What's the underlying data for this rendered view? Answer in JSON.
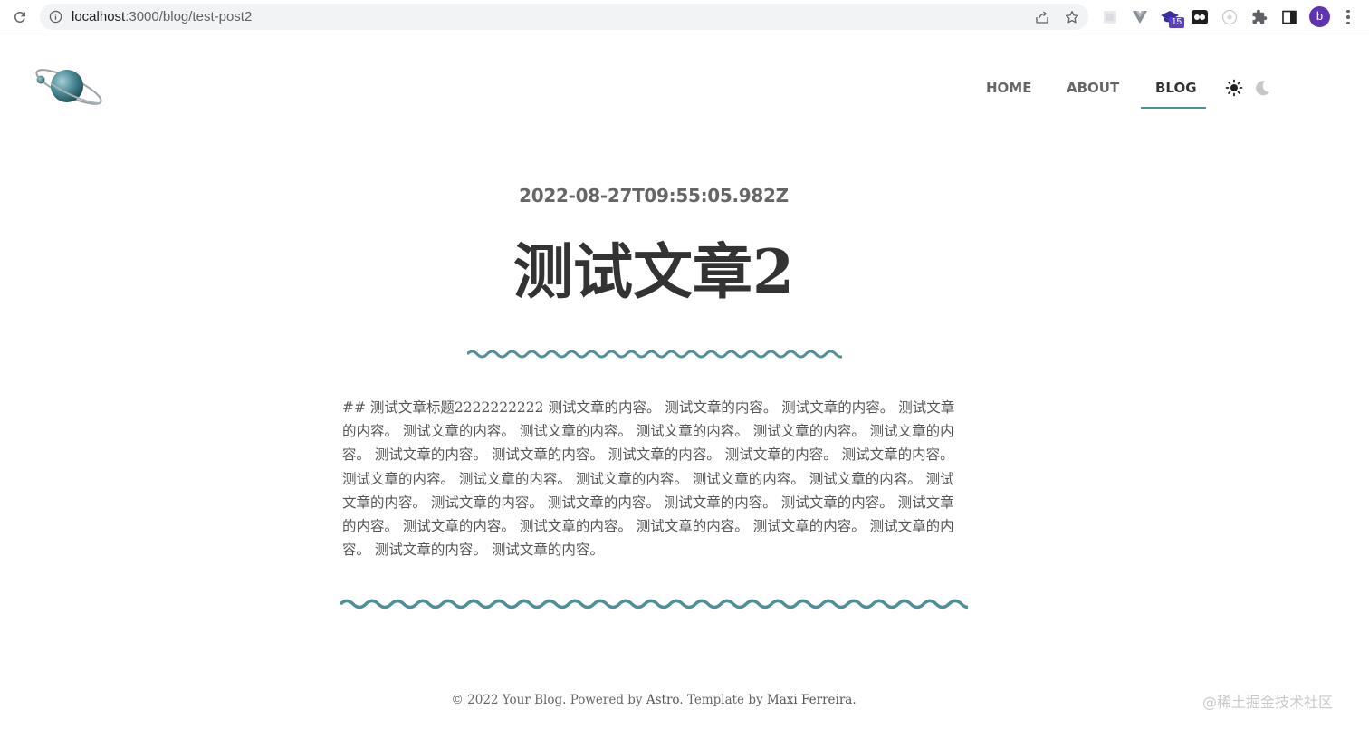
{
  "browser": {
    "url_host": "localhost",
    "url_rest": ":3000/blog/test-post2",
    "extension_badge": "15",
    "profile_initial": "b"
  },
  "nav": {
    "home": "HOME",
    "about": "ABOUT",
    "blog": "BLOG",
    "active": "BLOG"
  },
  "post": {
    "date": "2022-08-27T09:55:05.982Z",
    "title": "测试文章2",
    "content": "## 测试文章标题2222222222 测试文章的内容。 测试文章的内容。 测试文章的内容。 测试文章的内容。 测试文章的内容。 测试文章的内容。 测试文章的内容。 测试文章的内容。 测试文章的内容。 测试文章的内容。 测试文章的内容。 测试文章的内容。 测试文章的内容。 测试文章的内容。 测试文章的内容。 测试文章的内容。 测试文章的内容。 测试文章的内容。 测试文章的内容。 测试文章的内容。 测试文章的内容。 测试文章的内容。 测试文章的内容。 测试文章的内容。 测试文章的内容。 测试文章的内容。 测试文章的内容。 测试文章的内容。 测试文章的内容。 测试文章的内容。 测试文章的内容。 测试文章的内容。"
  },
  "footer": {
    "prefix": "© 2022 Your Blog. Powered by ",
    "astro_link": "Astro",
    "middle": ". Template by ",
    "author_link": "Maxi Ferreira",
    "suffix": "."
  },
  "watermark": "@稀土掘金技术社区",
  "colors": {
    "accent": "#4f8f9a",
    "text": "#333333",
    "muted": "#666666"
  },
  "icons": {
    "reload": "reload-icon",
    "info": "info-icon",
    "share": "share-icon",
    "star": "bookmark-star-icon",
    "sun": "sun-icon",
    "moon": "moon-icon",
    "logo": "planet-logo"
  }
}
